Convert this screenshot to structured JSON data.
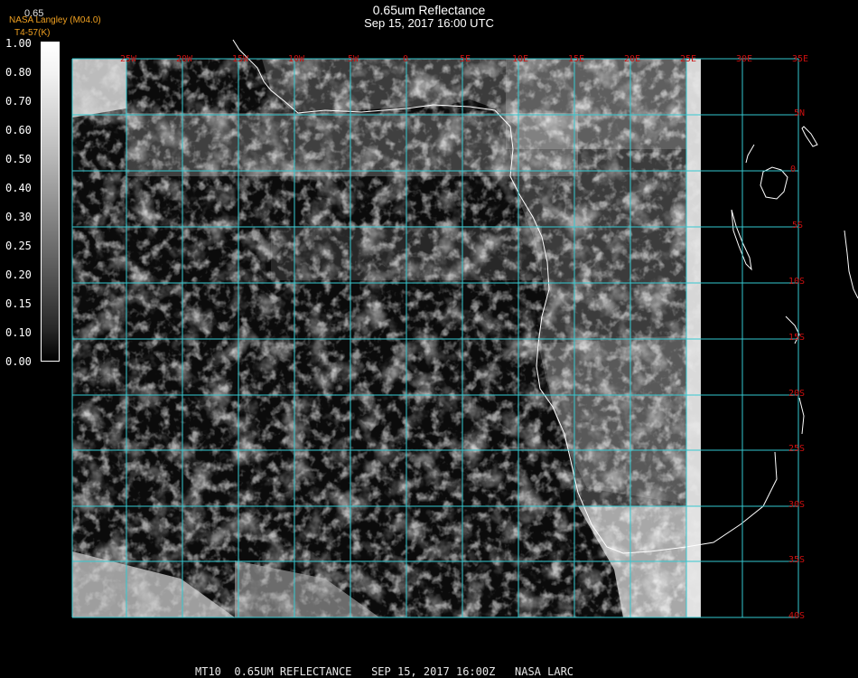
{
  "header": {
    "title": "0.65um Reflectance",
    "subtitle": "Sep 15, 2017 16:00 UTC"
  },
  "credit": {
    "agency": "NASA Langley (M04.0)",
    "version": "T4-57(K)",
    "value": "0.65"
  },
  "legend": {
    "labels": [
      "1.00",
      "0.80",
      "0.70",
      "0.60",
      "0.50",
      "0.40",
      "0.30",
      "0.25",
      "0.20",
      "0.15",
      "0.10",
      "0.00"
    ]
  },
  "grid": {
    "lon_labels": [
      "25W",
      "20W",
      "15W",
      "10W",
      "5W",
      "0",
      "5E",
      "10E",
      "15E",
      "20E",
      "25E",
      "30E",
      "35E"
    ],
    "lat_labels": [
      "5N",
      "0",
      "5S",
      "10S",
      "15S",
      "20S",
      "25S",
      "30S",
      "35S",
      "40S"
    ]
  },
  "footer": {
    "text": "MT10  0.65UM REFLECTANCE   SEP 15, 2017 16:00Z   NASA LARC"
  },
  "colors": {
    "grid": "#35c8d0",
    "labels": "#cc1010",
    "coast": "#ffffff",
    "credit": "#f0a020"
  }
}
